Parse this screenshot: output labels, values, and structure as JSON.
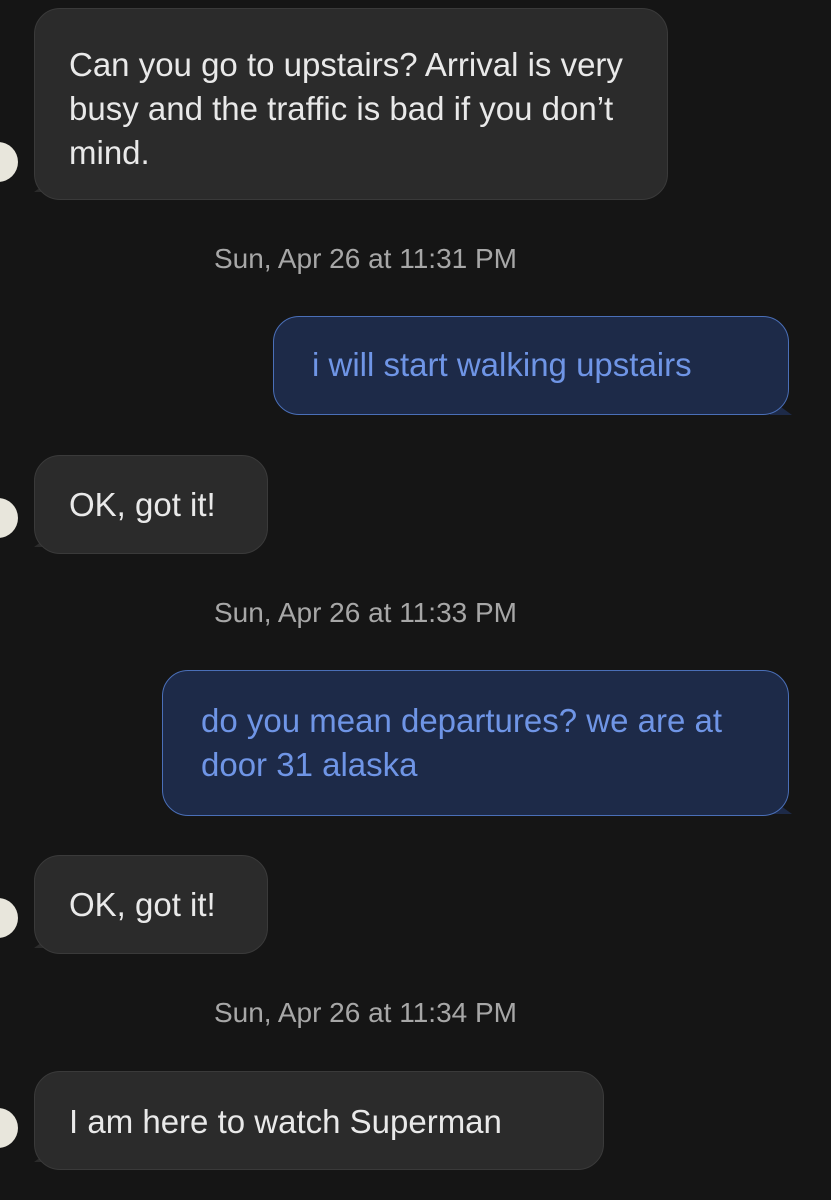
{
  "conversation": {
    "messages": [
      {
        "direction": "incoming",
        "text": "Can you go to upstairs? Arrival is very busy and the traffic is bad if you don’t mind."
      },
      {
        "timestamp": "Sun, Apr 26 at 11:31 PM"
      },
      {
        "direction": "outgoing",
        "text": "i will start walking upstairs"
      },
      {
        "direction": "incoming",
        "text": "OK, got it!"
      },
      {
        "timestamp": "Sun, Apr 26 at 11:33 PM"
      },
      {
        "direction": "outgoing",
        "text": "do you mean departures? we are at door 31 alaska"
      },
      {
        "direction": "incoming",
        "text": "OK, got it!"
      },
      {
        "timestamp": "Sun, Apr 26 at 11:34 PM"
      },
      {
        "direction": "incoming",
        "text": "I am here to watch Superman"
      }
    ]
  },
  "colors": {
    "background": "#151515",
    "incoming_bubble": "#2b2b2b",
    "outgoing_bubble": "#1d2a48",
    "outgoing_border": "#4a6fb8",
    "outgoing_text": "#6f95e6",
    "incoming_text": "#e9e9e9",
    "timestamp_text": "#a7a7a7"
  }
}
